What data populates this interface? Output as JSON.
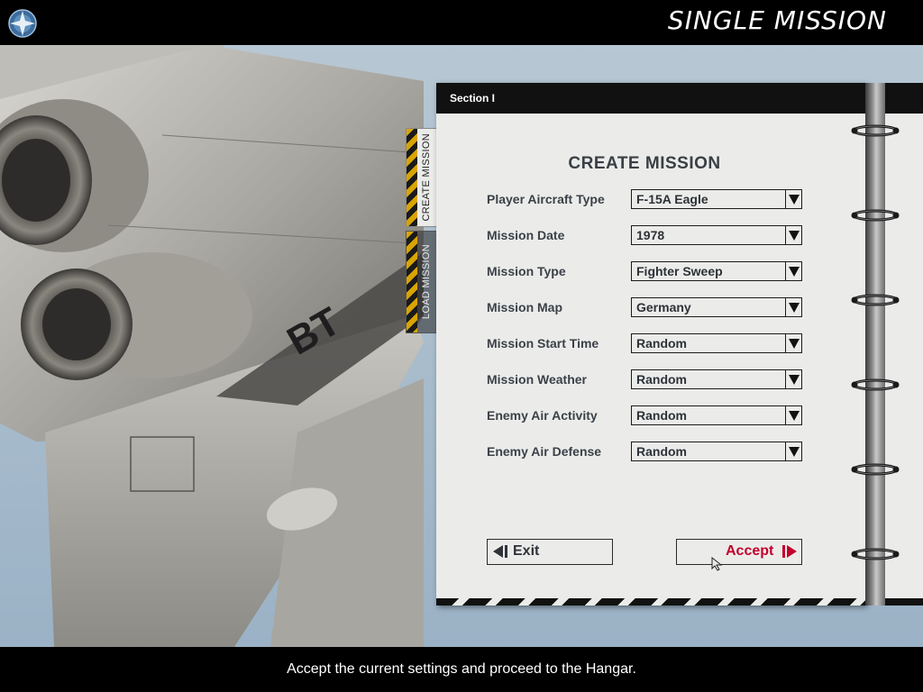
{
  "header": {
    "title": "SINGLE MISSION"
  },
  "binder": {
    "section_label": "Section I"
  },
  "tabs": [
    {
      "label": "CREATE MISSION",
      "active": true
    },
    {
      "label": "LOAD MISSION",
      "active": false
    }
  ],
  "form": {
    "title": "CREATE MISSION",
    "fields": [
      {
        "label": "Player Aircraft Type",
        "value": "F-15A Eagle"
      },
      {
        "label": "Mission Date",
        "value": "1978"
      },
      {
        "label": "Mission Type",
        "value": "Fighter Sweep"
      },
      {
        "label": "Mission Map",
        "value": "Germany"
      },
      {
        "label": "Mission Start Time",
        "value": "Random"
      },
      {
        "label": "Mission Weather",
        "value": "Random"
      },
      {
        "label": "Enemy Air Activity",
        "value": "Random"
      },
      {
        "label": "Enemy Air Defense",
        "value": "Random"
      }
    ]
  },
  "buttons": {
    "exit": "Exit",
    "accept": "Accept"
  },
  "status": {
    "text": "Accept the current settings and proceed to the Hangar."
  },
  "colors": {
    "accent_red": "#c3002c",
    "panel": "#ebecea",
    "bar": "#000000",
    "hazard_yellow": "#d9a400"
  },
  "icons": {
    "logo": "star-globe-icon",
    "exit": "arrow-left-bar-icon",
    "accept": "arrow-right-bar-icon",
    "dropdown": "triangle-down-icon",
    "cursor": "mouse-pointer-icon"
  }
}
